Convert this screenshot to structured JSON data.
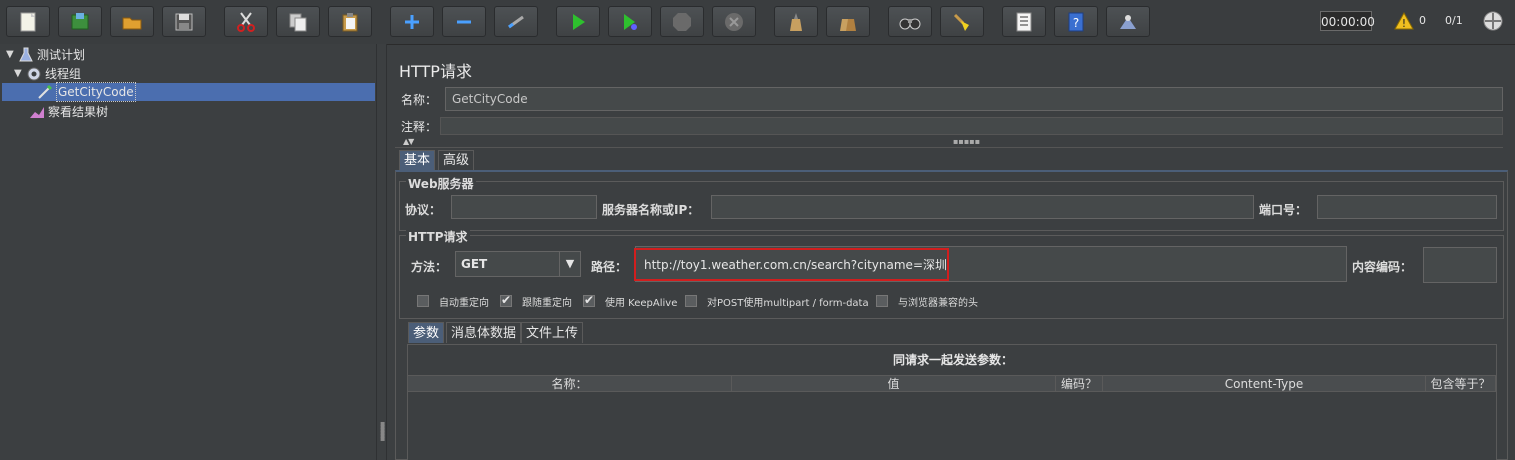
{
  "toolbar": {
    "buttons": [
      "new-icon",
      "templates-icon",
      "open-icon",
      "save-icon",
      "cut-icon",
      "copy-icon",
      "paste-icon",
      "expand-icon",
      "collapse-icon",
      "toggle-icon",
      "start-icon",
      "start-no-pause-icon",
      "stop-icon",
      "shutdown-icon",
      "clear-icon",
      "clear-all-icon",
      "search-icon",
      "reset-search-icon",
      "function-helper-icon",
      "help-icon",
      "remote-icon"
    ],
    "timer": "00:00:00",
    "warnings": "0",
    "threads": "0/1"
  },
  "tree": {
    "items": [
      {
        "label": "测试计划"
      },
      {
        "label": "线程组"
      },
      {
        "label": "GetCityCode"
      },
      {
        "label": "察看结果树"
      }
    ]
  },
  "panel": {
    "title": "HTTP请求",
    "name_label": "名称：",
    "name_value": "GetCityCode",
    "comment_label": "注释："
  },
  "tabs": {
    "basic": "基本",
    "advanced": "高级"
  },
  "web_server": {
    "title": "Web服务器",
    "protocol_label": "协议：",
    "protocol_value": "",
    "server_label": "服务器名称或IP：",
    "server_value": "",
    "port_label": "端口号：",
    "port_value": ""
  },
  "http_request": {
    "title": "HTTP请求",
    "method_label": "方法：",
    "method_value": "GET",
    "path_label": "路径：",
    "path_value": "http://toy1.weather.com.cn/search?cityname=深圳",
    "encoding_label": "内容编码：",
    "encoding_value": ""
  },
  "options": [
    {
      "label": "自动重定向",
      "checked": false
    },
    {
      "label": "跟随重定向",
      "checked": true
    },
    {
      "label": "使用 KeepAlive",
      "checked": true
    },
    {
      "label": "对POST使用multipart / form-data",
      "checked": false
    },
    {
      "label": "与浏览器兼容的头",
      "checked": false
    }
  ],
  "subtabs": {
    "params": "参数",
    "body": "消息体数据",
    "files": "文件上传"
  },
  "params_table": {
    "title": "同请求一起发送参数：",
    "columns": [
      "名称：",
      "值",
      "编码？",
      "Content-Type",
      "包含等于？"
    ]
  },
  "colors": {
    "background": "#3c3f41",
    "selection": "#4b6eaf",
    "highlight_box": "#d21e1e"
  }
}
